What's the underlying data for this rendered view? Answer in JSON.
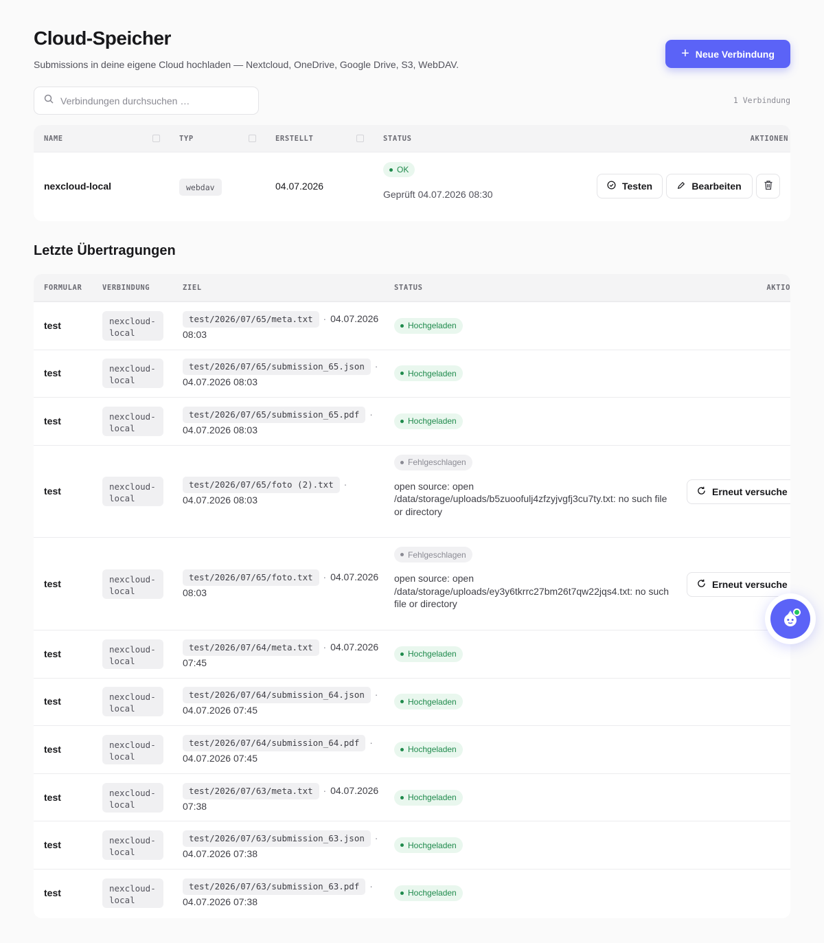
{
  "header": {
    "title": "Cloud-Speicher",
    "subtitle": "Submissions in deine eigene Cloud hochladen — Nextcloud, OneDrive, Google Drive, S3, WebDAV.",
    "new_button": "Neue Verbindung"
  },
  "search": {
    "placeholder": "Verbindungen durchsuchen …",
    "value": ""
  },
  "count_label": "1 Verbindung",
  "connections": {
    "columns": [
      "NAME",
      "TYP",
      "ERSTELLT",
      "STATUS",
      "AKTIONEN"
    ],
    "rows": [
      {
        "name": "nexcloud-local",
        "type": "webdav",
        "created": "04.07.2026",
        "status": "OK",
        "checked": "Geprüft 04.07.2026 08:30",
        "test_label": "Testen",
        "edit_label": "Bearbeiten"
      }
    ]
  },
  "transfers": {
    "title": "Letzte Übertragungen",
    "columns": [
      "FORMULAR",
      "VERBINDUNG",
      "ZIEL",
      "STATUS",
      "AKTIO"
    ],
    "retry_label": "Erneut versuche",
    "rows": [
      {
        "form": "test",
        "conn": "nexcloud-local",
        "path": "test/2026/07/65/meta.txt",
        "time": "04.07.2026 08:03",
        "status": "Hochgeladen",
        "ok": true,
        "error": ""
      },
      {
        "form": "test",
        "conn": "nexcloud-local",
        "path": "test/2026/07/65/submission_65.json",
        "time": "04.07.2026 08:03",
        "status": "Hochgeladen",
        "ok": true,
        "error": ""
      },
      {
        "form": "test",
        "conn": "nexcloud-local",
        "path": "test/2026/07/65/submission_65.pdf",
        "time": "04.07.2026 08:03",
        "status": "Hochgeladen",
        "ok": true,
        "error": ""
      },
      {
        "form": "test",
        "conn": "nexcloud-local",
        "path": "test/2026/07/65/foto (2).txt",
        "time": "04.07.2026 08:03",
        "status": "Fehlgeschlagen",
        "ok": false,
        "error": "open source: open /data/storage/uploads/b5zuoofulj4zfzyjvgfj3cu7ty.txt: no such file or directory"
      },
      {
        "form": "test",
        "conn": "nexcloud-local",
        "path": "test/2026/07/65/foto.txt",
        "time": "04.07.2026 08:03",
        "status": "Fehlgeschlagen",
        "ok": false,
        "error": "open source: open /data/storage/uploads/ey3y6tkrrc27bm26t7qw22jqs4.txt: no such file or directory"
      },
      {
        "form": "test",
        "conn": "nexcloud-local",
        "path": "test/2026/07/64/meta.txt",
        "time": "04.07.2026 07:45",
        "status": "Hochgeladen",
        "ok": true,
        "error": ""
      },
      {
        "form": "test",
        "conn": "nexcloud-local",
        "path": "test/2026/07/64/submission_64.json",
        "time": "04.07.2026 07:45",
        "status": "Hochgeladen",
        "ok": true,
        "error": ""
      },
      {
        "form": "test",
        "conn": "nexcloud-local",
        "path": "test/2026/07/64/submission_64.pdf",
        "time": "04.07.2026 07:45",
        "status": "Hochgeladen",
        "ok": true,
        "error": ""
      },
      {
        "form": "test",
        "conn": "nexcloud-local",
        "path": "test/2026/07/63/meta.txt",
        "time": "04.07.2026 07:38",
        "status": "Hochgeladen",
        "ok": true,
        "error": ""
      },
      {
        "form": "test",
        "conn": "nexcloud-local",
        "path": "test/2026/07/63/submission_63.json",
        "time": "04.07.2026 07:38",
        "status": "Hochgeladen",
        "ok": true,
        "error": ""
      },
      {
        "form": "test",
        "conn": "nexcloud-local",
        "path": "test/2026/07/63/submission_63.pdf",
        "time": "04.07.2026 07:38",
        "status": "Hochgeladen",
        "ok": true,
        "error": ""
      }
    ]
  },
  "colors": {
    "accent": "#5b63f7",
    "success": "#1f8a4c",
    "success_bg": "#e9f7ee",
    "muted": "#8a8a93"
  }
}
